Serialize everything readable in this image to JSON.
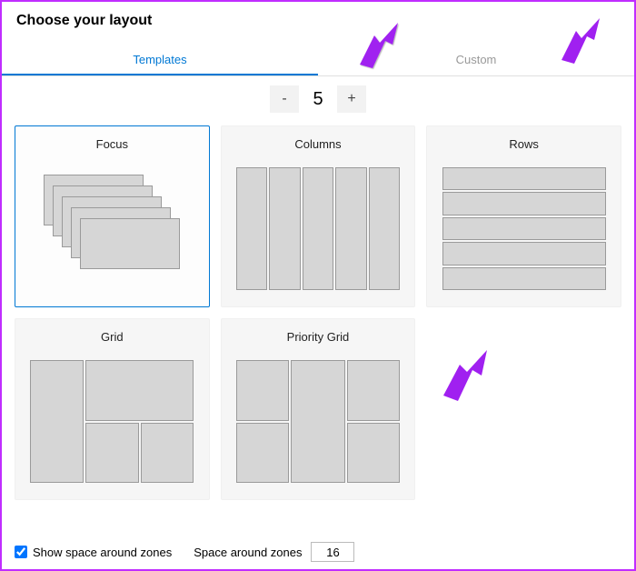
{
  "title": "Choose your layout",
  "tabs": {
    "templates": "Templates",
    "custom": "Custom"
  },
  "stepper": {
    "minus": "-",
    "value": "5",
    "plus": "+"
  },
  "cards": {
    "focus": "Focus",
    "columns": "Columns",
    "rows": "Rows",
    "grid": "Grid",
    "priority_grid": "Priority Grid"
  },
  "footer": {
    "show_space_label": "Show space around zones",
    "show_space_checked": true,
    "space_label": "Space around zones",
    "space_value": "16"
  },
  "colors": {
    "accent": "#0078d4",
    "annotation": "#a020f0"
  }
}
